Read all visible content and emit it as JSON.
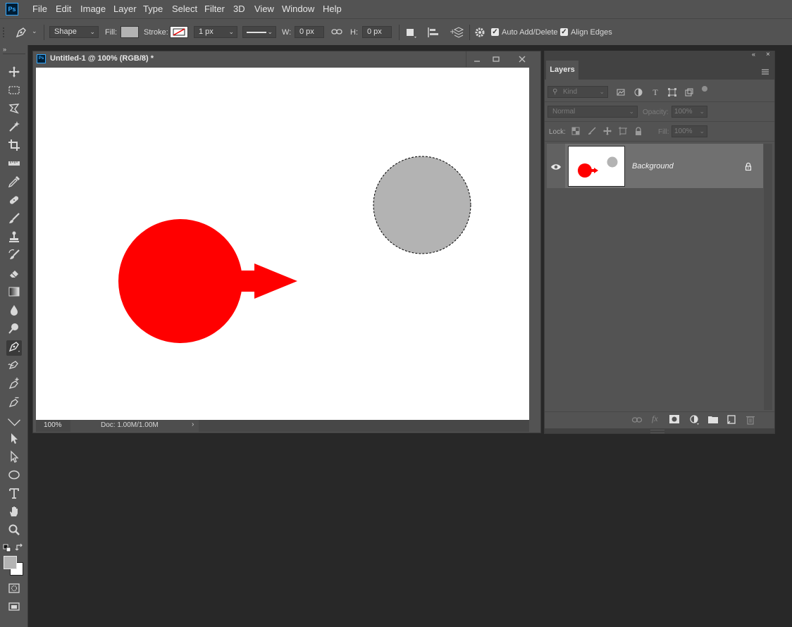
{
  "app": {
    "logo_text": "Ps"
  },
  "menu": [
    "File",
    "Edit",
    "Image",
    "Layer",
    "Type",
    "Select",
    "Filter",
    "3D",
    "View",
    "Window",
    "Help"
  ],
  "options_bar": {
    "mode": "Shape",
    "fill_label": "Fill:",
    "fill_color": "#b3b3b3",
    "stroke_label": "Stroke:",
    "stroke_width": "1 px",
    "w_label": "W:",
    "w_value": "0 px",
    "h_label": "H:",
    "h_value": "0 px",
    "auto_add_delete": "Auto Add/Delete",
    "align_edges": "Align Edges",
    "auto_add_delete_checked": true,
    "align_edges_checked": true
  },
  "document": {
    "title": "Untitled-1 @ 100% (RGB/8) *",
    "zoom": "100%",
    "doc_size": "Doc: 1.00M/1.00M",
    "shape_colors": {
      "red": "#ff0000",
      "gray": "#b3b3b3"
    }
  },
  "layers_panel": {
    "tab": "Layers",
    "kind_placeholder": "Kind",
    "blend_mode": "Normal",
    "opacity_label": "Opacity:",
    "opacity_value": "100%",
    "lock_label": "Lock:",
    "fill_label": "Fill:",
    "fill_value": "100%",
    "layers": [
      {
        "name": "Background",
        "visible": true,
        "locked": true
      }
    ]
  },
  "toolbar": {
    "tools": [
      "move",
      "marquee",
      "lasso",
      "magic-wand",
      "crop",
      "ruler",
      "eyedropper",
      "healing",
      "brush",
      "stamp",
      "history-brush",
      "eraser",
      "gradient",
      "blur",
      "dodge",
      "pen",
      "freeform-pen",
      "add-anchor",
      "delete-anchor",
      "convert-point",
      "path-select",
      "direct-select",
      "ellipse",
      "type",
      "hand",
      "zoom"
    ],
    "active_tool": "pen",
    "foreground_color": "#b3b3b3",
    "background_color": "#ffffff"
  }
}
